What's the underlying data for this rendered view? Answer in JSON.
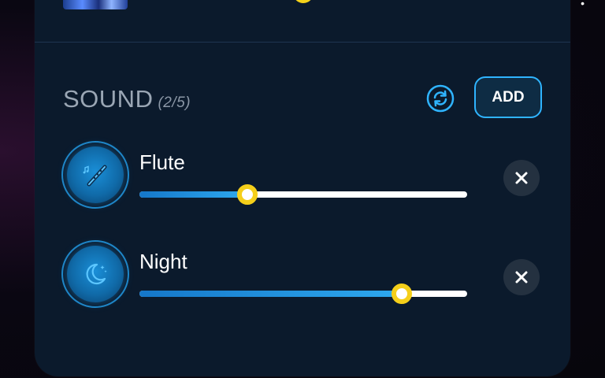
{
  "sound_section": {
    "title": "SOUND",
    "count": "(2/5)",
    "add_label": "ADD",
    "refresh_icon": "refresh-icon",
    "accent_color": "#2fb4ff",
    "thumb_color": "#f5cf1a"
  },
  "sounds": [
    {
      "name": "Flute",
      "icon": "flute-icon",
      "volume_percent": 33
    },
    {
      "name": "Night",
      "icon": "moon-icon",
      "volume_percent": 80
    }
  ],
  "remove_icon": "close-icon"
}
